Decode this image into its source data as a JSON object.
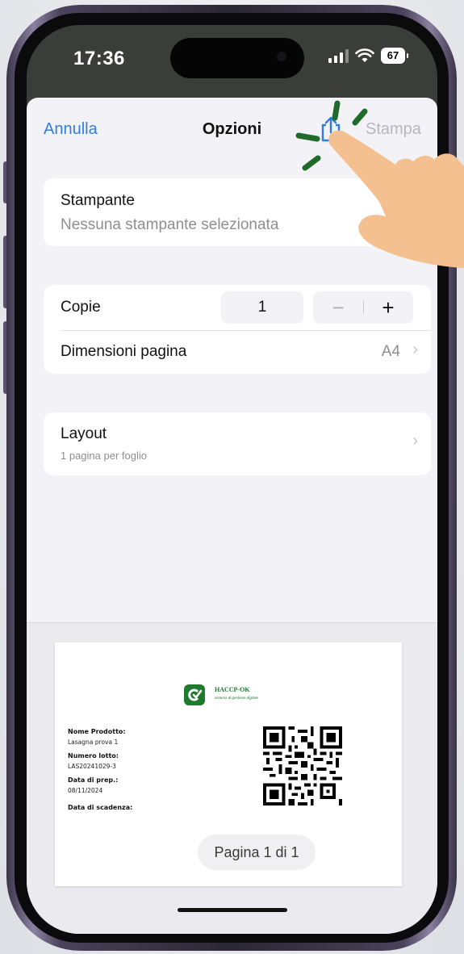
{
  "status_bar": {
    "time": "17:36",
    "battery": "67"
  },
  "nav": {
    "cancel_label": "Annulla",
    "title": "Opzioni",
    "print_label": "Stampa",
    "share_icon": "share-icon"
  },
  "printer": {
    "label": "Stampante",
    "value": "Nessuna stampante selezionata"
  },
  "copies": {
    "label": "Copie",
    "value": "1",
    "minus": "−",
    "plus": "+"
  },
  "page_size": {
    "label": "Dimensioni pagina",
    "value": "A4",
    "chevron": "›"
  },
  "layout": {
    "label": "Layout",
    "value": "1 pagina per foglio",
    "chevron": "›"
  },
  "preview": {
    "brand": "HACCP-OK",
    "brand_sub": "sistema di gestione digitale",
    "fields": [
      {
        "label": "Nome Prodotto:",
        "value": "Lasagna prova 1"
      },
      {
        "label": "Numero lotto:",
        "value": "LAS20241029-3"
      },
      {
        "label": "Data di prep.:",
        "value": "08/11/2024"
      },
      {
        "label": "Data di scadenza:",
        "value": ""
      }
    ],
    "page_indicator": "Pagina 1 di 1"
  },
  "colors": {
    "accent": "#2f7de1",
    "brand_green": "#1f7a2e",
    "disabled": "#b6b8bd",
    "tap_marks": "#1e6b2b",
    "hand": "#f5c090"
  }
}
